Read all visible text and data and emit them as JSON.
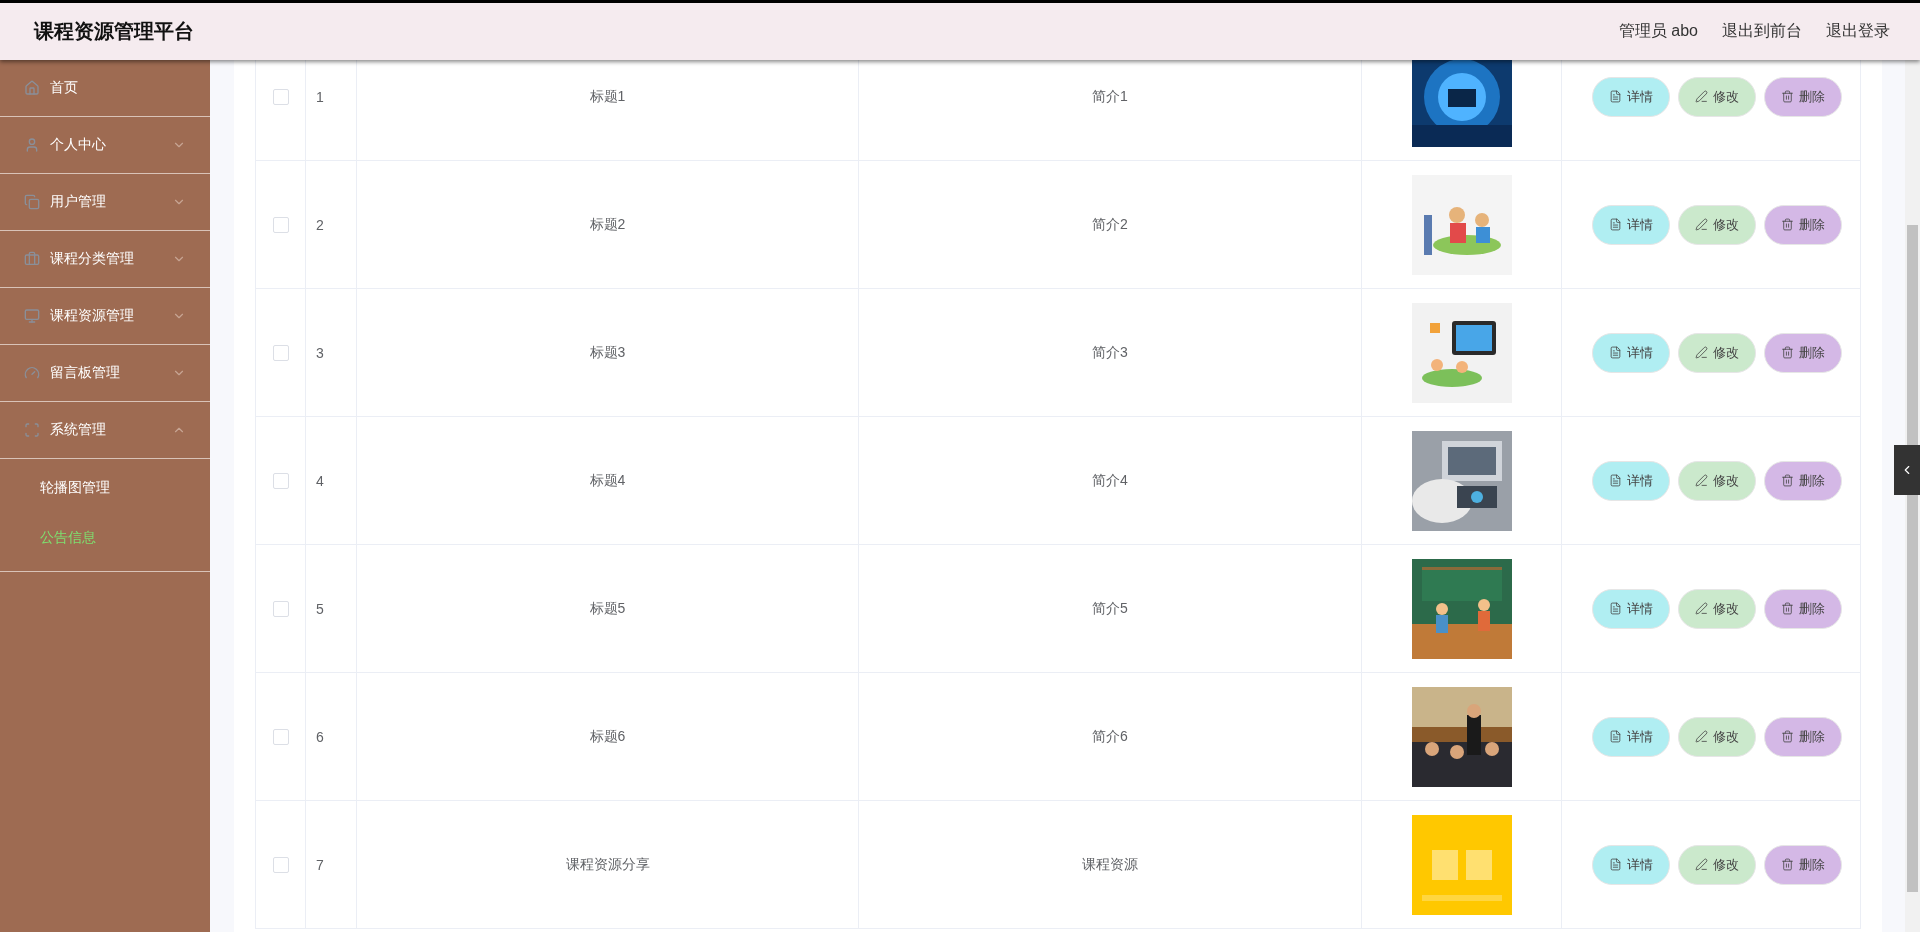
{
  "header": {
    "title": "课程资源管理平台",
    "links": [
      "管理员 abo",
      "退出到前台",
      "退出登录"
    ]
  },
  "sidebar": {
    "items": [
      {
        "label": "首页",
        "kind": "link"
      },
      {
        "label": "个人中心",
        "kind": "submenu",
        "expanded": false
      },
      {
        "label": "用户管理",
        "kind": "submenu",
        "expanded": false
      },
      {
        "label": "课程分类管理",
        "kind": "submenu",
        "expanded": false
      },
      {
        "label": "课程资源管理",
        "kind": "submenu",
        "expanded": false
      },
      {
        "label": "留言板管理",
        "kind": "submenu",
        "expanded": false
      },
      {
        "label": "系统管理",
        "kind": "submenu",
        "expanded": true,
        "children": [
          {
            "label": "轮播图管理",
            "selected": false
          },
          {
            "label": "公告信息",
            "selected": true
          }
        ]
      }
    ]
  },
  "table": {
    "rows": [
      {
        "checked": false,
        "index": "1",
        "title": "标题1",
        "intro": "简介1",
        "actions": [
          {
            "label": "详情",
            "kind": "detail"
          },
          {
            "label": "修改",
            "kind": "edit"
          },
          {
            "label": "删除",
            "kind": "delete"
          }
        ]
      },
      {
        "checked": false,
        "index": "2",
        "title": "标题2",
        "intro": "简介2",
        "actions": [
          {
            "label": "详情",
            "kind": "detail"
          },
          {
            "label": "修改",
            "kind": "edit"
          },
          {
            "label": "删除",
            "kind": "delete"
          }
        ]
      },
      {
        "checked": false,
        "index": "3",
        "title": "标题3",
        "intro": "简介3",
        "actions": [
          {
            "label": "详情",
            "kind": "detail"
          },
          {
            "label": "修改",
            "kind": "edit"
          },
          {
            "label": "删除",
            "kind": "delete"
          }
        ]
      },
      {
        "checked": false,
        "index": "4",
        "title": "标题4",
        "intro": "简介4",
        "actions": [
          {
            "label": "详情",
            "kind": "detail"
          },
          {
            "label": "修改",
            "kind": "edit"
          },
          {
            "label": "删除",
            "kind": "delete"
          }
        ]
      },
      {
        "checked": false,
        "index": "5",
        "title": "标题5",
        "intro": "简介5",
        "actions": [
          {
            "label": "详情",
            "kind": "detail"
          },
          {
            "label": "修改",
            "kind": "edit"
          },
          {
            "label": "删除",
            "kind": "delete"
          }
        ]
      },
      {
        "checked": false,
        "index": "6",
        "title": "标题6",
        "intro": "简介6",
        "actions": [
          {
            "label": "详情",
            "kind": "detail"
          },
          {
            "label": "修改",
            "kind": "edit"
          },
          {
            "label": "删除",
            "kind": "delete"
          }
        ]
      },
      {
        "checked": false,
        "index": "7",
        "title": "课程资源分享",
        "intro": "课程资源",
        "actions": [
          {
            "label": "详情",
            "kind": "detail"
          },
          {
            "label": "修改",
            "kind": "edit"
          },
          {
            "label": "删除",
            "kind": "delete"
          }
        ]
      }
    ]
  }
}
